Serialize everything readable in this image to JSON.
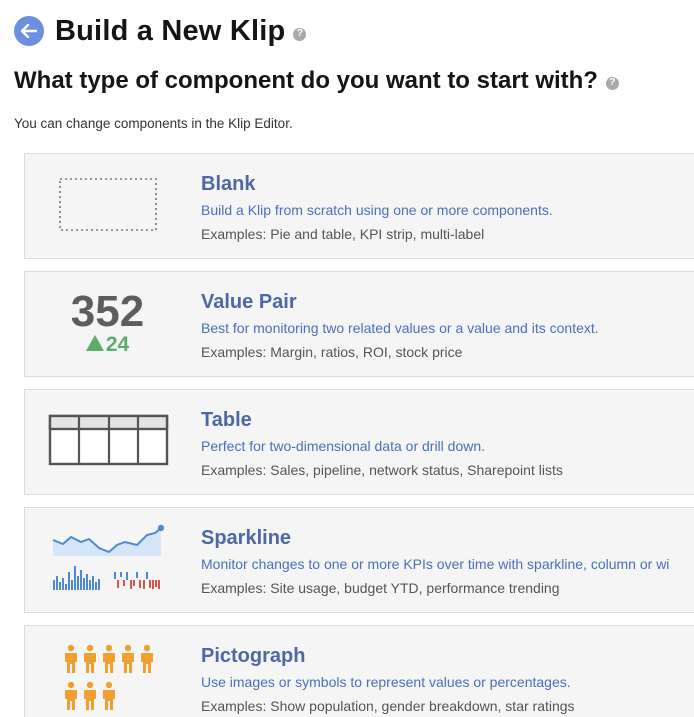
{
  "header": {
    "back_icon": "arrow-left-icon",
    "title": "Build a New Klip",
    "help_glyph": "?"
  },
  "question": {
    "text": "What type of component do you want to start with?",
    "help_glyph": "?"
  },
  "subtitle": "You can change components in the Klip Editor.",
  "colors": {
    "accent": "#6d8fe0",
    "card_title": "#4e67a6",
    "card_desc": "#4a6fbd",
    "positive": "#5cae6a",
    "sparkline_blue": "#4f8ad0",
    "sparkline_red": "#d9534f",
    "pictograph_orange": "#f0a030"
  },
  "components": [
    {
      "title": "Blank",
      "description": "Build a Klip from scratch using one or more components.",
      "examples": "Examples: Pie and table, KPI strip, multi-label",
      "icon": "blank-placeholder-icon"
    },
    {
      "title": "Value Pair",
      "description": "Best for monitoring two related values or a value and its context.",
      "examples": "Examples: Margin, ratios, ROI, stock price",
      "icon": "value-pair-icon",
      "thumb_value": "352",
      "thumb_delta": "24"
    },
    {
      "title": "Table",
      "description": "Perfect for two-dimensional data or drill down.",
      "examples": "Examples: Sales, pipeline, network status, Sharepoint lists",
      "icon": "table-icon"
    },
    {
      "title": "Sparkline",
      "description": "Monitor changes to one or more KPIs over time with sparkline, column or wi",
      "examples": "Examples: Site usage, budget YTD, performance trending",
      "icon": "sparkline-icon"
    },
    {
      "title": "Pictograph",
      "description": "Use images or symbols to represent values or percentages.",
      "examples": "Examples: Show population, gender breakdown, star ratings",
      "icon": "pictograph-icon",
      "figure_count": 8
    }
  ]
}
